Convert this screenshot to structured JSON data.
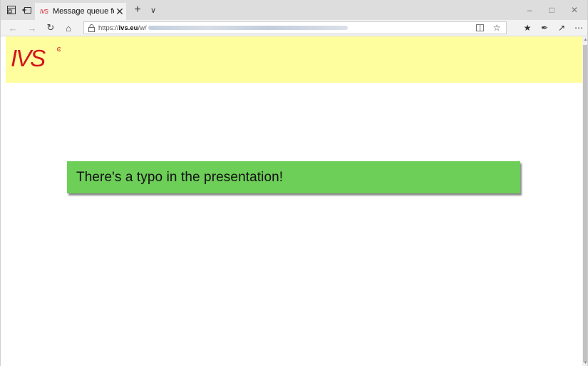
{
  "browser": {
    "tab": {
      "favicon_text": "IVS",
      "title": "Message queue for mar",
      "close_glyph": "✕"
    },
    "new_tab_glyph": "+",
    "tab_list_glyph": "∨",
    "window_controls": {
      "minimize": "–",
      "maximize": "□",
      "close": "✕"
    },
    "nav": {
      "back": "←",
      "forward": "→",
      "refresh": "↻",
      "home": "⌂"
    },
    "address": {
      "prefix": "https://",
      "domain": "ivs.eu",
      "path": "/w/"
    },
    "toolbar": {
      "favorites_glyph": "☆",
      "favorites_bar_glyph": "★",
      "notes_glyph": "✒",
      "share_glyph": "↗",
      "more_glyph": "⋯"
    }
  },
  "page": {
    "logo_text": "IVS",
    "logo_color": "#d4141e",
    "header_color": "#fffe9f",
    "message": "There's a typo in the presentation!",
    "message_color": "#6dce58"
  },
  "scrollbar": {
    "up": "▲",
    "down": "▼"
  }
}
